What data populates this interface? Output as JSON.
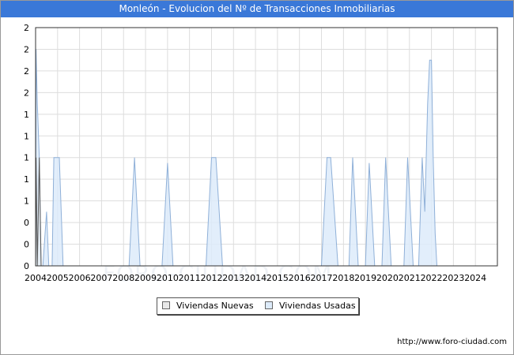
{
  "title": "Monleón - Evolucion del Nº de Transacciones Inmobiliarias",
  "footer_url": "http://www.foro-ciudad.com",
  "watermark": "FORO-CIUDAD.COM",
  "colors": {
    "title_bg": "#3a78d8",
    "nuevas_fill": "#e8e8e8",
    "usadas_fill": "#ddebfa",
    "usadas_line": "#8fb0d8",
    "grid": "#dddddd"
  },
  "chart_data": {
    "type": "area",
    "title": "Monleón - Evolucion del Nº de Transacciones Inmobiliarias",
    "xlabel": "",
    "ylabel": "",
    "xlim": [
      2004,
      2025
    ],
    "ylim": [
      0,
      2.2
    ],
    "x_tick_labels": [
      "2004",
      "2005",
      "2006",
      "2007",
      "2008",
      "2009",
      "2010",
      "2011",
      "2012",
      "2013",
      "2014",
      "2015",
      "2016",
      "2017",
      "2018",
      "2019",
      "2020",
      "2021",
      "2022",
      "2023",
      "2024"
    ],
    "y_tick_labels": [
      "0",
      "0",
      "0",
      "1",
      "1",
      "1",
      "1",
      "1",
      "2",
      "2",
      "2",
      "2"
    ],
    "legend_position": "bottom-center",
    "grid": true,
    "series": [
      {
        "name": "Viviendas Nuevas",
        "points": [
          [
            2004.0,
            0
          ],
          [
            2004.02,
            1
          ],
          [
            2004.08,
            0
          ],
          [
            2004.17,
            1
          ],
          [
            2004.25,
            0
          ]
        ]
      },
      {
        "name": "Viviendas Usadas",
        "points": [
          [
            2004.0,
            0
          ],
          [
            2004.02,
            2
          ],
          [
            2004.08,
            1.5
          ],
          [
            2004.17,
            1
          ],
          [
            2004.25,
            0
          ],
          [
            2004.33,
            0
          ],
          [
            2004.5,
            0.5
          ],
          [
            2004.6,
            0
          ],
          [
            2004.75,
            0
          ],
          [
            2004.83,
            1
          ],
          [
            2004.92,
            1
          ],
          [
            2005.0,
            1
          ],
          [
            2005.08,
            1
          ],
          [
            2005.25,
            0
          ],
          [
            2008.25,
            0
          ],
          [
            2008.5,
            1
          ],
          [
            2008.75,
            0
          ],
          [
            2009.75,
            0
          ],
          [
            2010.0,
            0.95
          ],
          [
            2010.25,
            0
          ],
          [
            2011.75,
            0
          ],
          [
            2012.0,
            1
          ],
          [
            2012.2,
            1
          ],
          [
            2012.5,
            0
          ],
          [
            2017.0,
            0
          ],
          [
            2017.25,
            1
          ],
          [
            2017.42,
            1
          ],
          [
            2017.75,
            0
          ],
          [
            2018.25,
            0
          ],
          [
            2018.42,
            1
          ],
          [
            2018.67,
            0
          ],
          [
            2019.0,
            0
          ],
          [
            2019.17,
            0.95
          ],
          [
            2019.42,
            0
          ],
          [
            2019.75,
            0
          ],
          [
            2019.92,
            1
          ],
          [
            2020.17,
            0
          ],
          [
            2020.75,
            0
          ],
          [
            2020.92,
            1
          ],
          [
            2021.17,
            0
          ],
          [
            2021.42,
            0
          ],
          [
            2021.58,
            1
          ],
          [
            2021.7,
            0.5
          ],
          [
            2021.83,
            1.5
          ],
          [
            2021.92,
            1.9
          ],
          [
            2022.0,
            1.9
          ],
          [
            2022.08,
            1
          ],
          [
            2022.17,
            0.3
          ],
          [
            2022.25,
            0
          ]
        ]
      }
    ]
  }
}
